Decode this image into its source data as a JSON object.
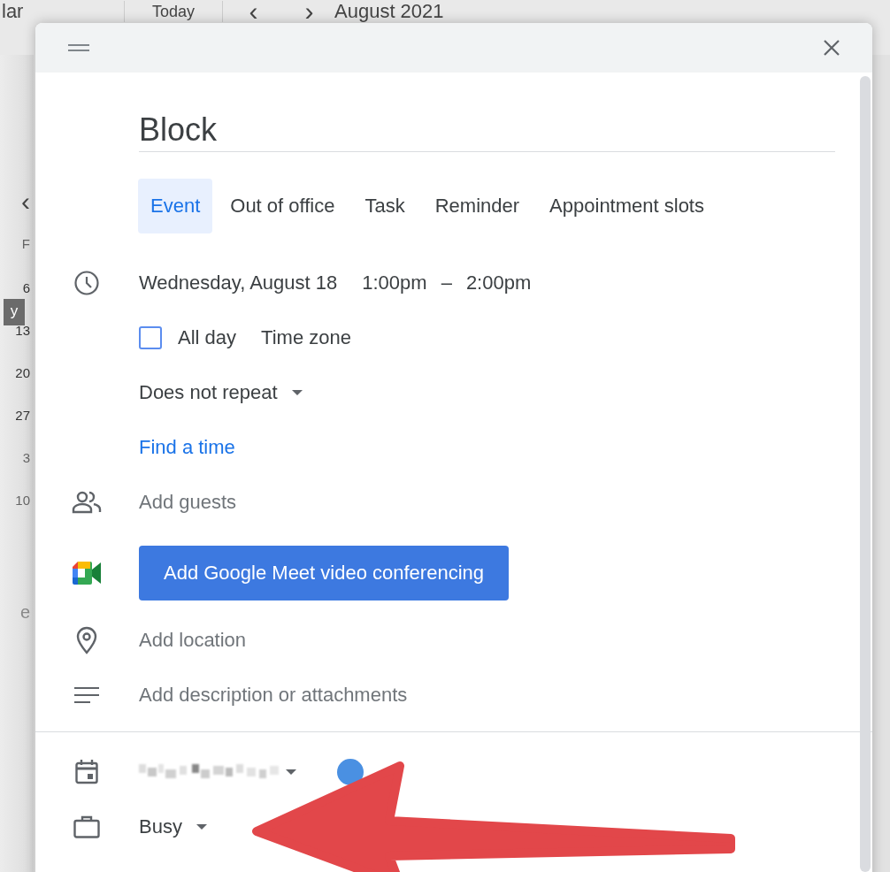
{
  "background": {
    "app_title": "lar",
    "today_button": "Today",
    "prev": "‹",
    "next": "›",
    "month_title": "August 2021",
    "mini_calendar": {
      "back": "‹",
      "day_header": "F",
      "dates": [
        "6",
        "13",
        "20",
        "27",
        "3",
        "10"
      ]
    },
    "tooltip": "y",
    "faded_text": "e"
  },
  "dialog": {
    "title": "Block",
    "tabs": [
      {
        "label": "Event",
        "selected": true
      },
      {
        "label": "Out of office",
        "selected": false
      },
      {
        "label": "Task",
        "selected": false
      },
      {
        "label": "Reminder",
        "selected": false
      },
      {
        "label": "Appointment slots",
        "selected": false
      }
    ],
    "date": "Wednesday, August 18",
    "start_time": "1:00pm",
    "dash": "–",
    "end_time": "2:00pm",
    "all_day": {
      "label": "All day",
      "checked": false
    },
    "time_zone": "Time zone",
    "repeat": "Does not repeat",
    "find_time": "Find a time",
    "guests": {
      "placeholder": "Add guests"
    },
    "meet_button": "Add Google Meet video conferencing",
    "location": {
      "placeholder": "Add location"
    },
    "description": {
      "placeholder": "Add description or attachments"
    },
    "calendar": {
      "color": "#4a90e2"
    },
    "availability": "Busy"
  },
  "annotation": {
    "kind": "arrow"
  }
}
